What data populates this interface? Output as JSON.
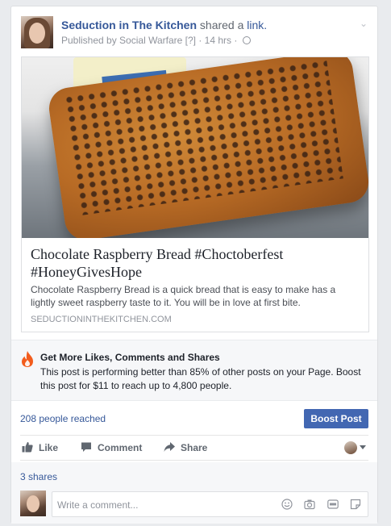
{
  "post": {
    "author": "Seduction in The Kitchen",
    "action_text": "shared a",
    "action_link": "link.",
    "meta_prefix": "Published by Social Warfare",
    "meta_help": "[?]",
    "meta_sep": "·",
    "time": "14 hrs",
    "meta_sep2": "·"
  },
  "preview": {
    "title": "Chocolate Raspberry Bread #Choctoberfest #HoneyGivesHope",
    "description": "Chocolate Raspberry Bread is a quick bread that is easy to make has a lightly sweet raspberry taste to it. You will be in love at first bite.",
    "domain": "SEDUCTIONINTHEKITCHEN.COM"
  },
  "promo": {
    "title": "Get More Likes, Comments and Shares",
    "text": "This post is performing better than 85% of other posts on your Page. Boost this post for $11 to reach up to 4,800 people."
  },
  "stats": {
    "reached": "208 people reached",
    "boost_label": "Boost Post",
    "shares": "3 shares"
  },
  "actions": {
    "like": "Like",
    "comment": "Comment",
    "share": "Share"
  },
  "comment_box": {
    "placeholder": "Write a comment..."
  },
  "icons": {
    "chevron": "chevron-down-icon",
    "globe": "globe-icon",
    "fire": "fire-icon",
    "like": "thumbs-up-icon",
    "comment": "speech-bubble-icon",
    "share": "share-arrow-icon",
    "emoji": "emoji-icon",
    "camera": "camera-icon",
    "gif": "gif-icon",
    "sticker": "sticker-icon"
  },
  "colors": {
    "link": "#365899",
    "boost_button": "#4267b2",
    "fire": "#f25c1d"
  }
}
